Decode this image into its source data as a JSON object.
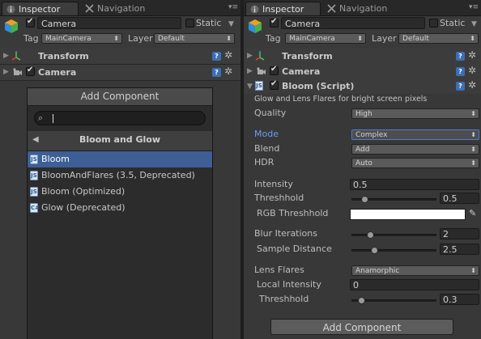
{
  "tabs": {
    "inspector": "Inspector",
    "navigation": "Navigation"
  },
  "object": {
    "name": "Camera",
    "static_label": "Static",
    "tag_label": "Tag",
    "tag_value": "MainCamera",
    "layer_label": "Layer",
    "layer_value": "Default"
  },
  "components": {
    "transform": "Transform",
    "camera": "Camera"
  },
  "add_component_label": "Add Component",
  "popup": {
    "title": "Add Component",
    "search_placeholder": "",
    "category": "Bloom and Glow",
    "items": [
      {
        "label": "Bloom",
        "selected": true
      },
      {
        "label": "BloomAndFlares (3.5, Deprecated)"
      },
      {
        "label": "Bloom (Optimized)"
      },
      {
        "label": "Glow (Deprecated)"
      }
    ]
  },
  "bloom": {
    "name": "Bloom (Script)",
    "description": "Glow and Lens Flares for bright screen pixels",
    "quality_label": "Quality",
    "quality_value": "High",
    "mode_label": "Mode",
    "mode_value": "Complex",
    "blend_label": "Blend",
    "blend_value": "Add",
    "hdr_label": "HDR",
    "hdr_value": "Auto",
    "intensity_label": "Intensity",
    "intensity_value": "0.5",
    "threshold_label": "Threshhold",
    "threshold_value": "0.5",
    "threshold_fraction": 0.12,
    "rgb_threshold_label": "RGB Threshhold",
    "rgb_threshold_color": "#ffffff",
    "blur_iterations_label": "Blur Iterations",
    "blur_iterations_value": "2",
    "blur_iterations_fraction": 0.2,
    "sample_distance_label": "Sample Distance",
    "sample_distance_value": "2.5",
    "sample_distance_fraction": 0.25,
    "lens_flares_label": "Lens Flares",
    "lens_flares_value": "Anamorphic",
    "local_intensity_label": "Local Intensity",
    "local_intensity_value": "0",
    "flare_threshold_label": "Threshhold",
    "flare_threshold_value": "0.3",
    "flare_threshold_fraction": 0.08
  },
  "colors": {
    "selection": "#3e5f96",
    "active_label": "#6d9ef0",
    "help_icon": "#3b6fb5"
  },
  "icons": [
    "inspector-icon",
    "navigation-icon",
    "cube-icon",
    "transform-icon",
    "camera-icon",
    "script-icon",
    "help-icon",
    "gear-icon",
    "search-icon",
    "back-arrow-icon",
    "color-picker-icon"
  ]
}
